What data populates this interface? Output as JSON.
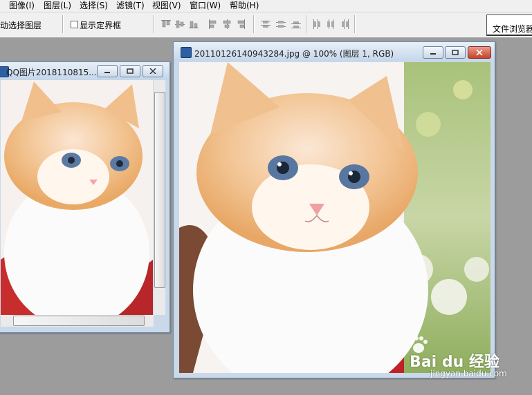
{
  "menu": {
    "items": [
      "图像(I)",
      "图层(L)",
      "选择(S)",
      "滤镜(T)",
      "视图(V)",
      "窗口(W)",
      "帮助(H)"
    ]
  },
  "options": {
    "auto_select": "动选择图层",
    "show_bounds": "显示定界框",
    "show_bounds_checked": false,
    "file_browser": "文件浏览器"
  },
  "window_left": {
    "title": "QQ图片2018110815..."
  },
  "window_main": {
    "title": "20110126140943284.jpg @ 100% (图层 1, RGB)"
  },
  "watermark": {
    "brand": "Bai du 经验",
    "url": "jingyan.baidu.com"
  },
  "colors": {
    "workspace": "#9c9c9c",
    "title_gradient": "#c4d6ea",
    "close_button": "#c8432b"
  }
}
